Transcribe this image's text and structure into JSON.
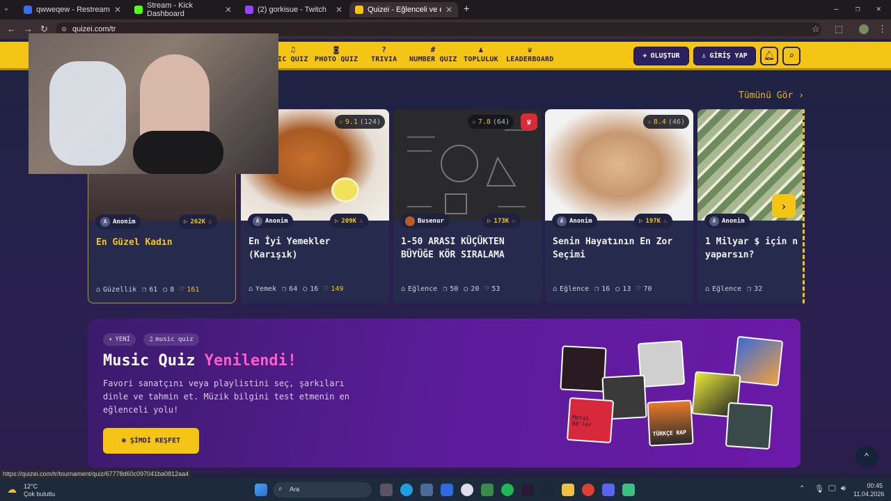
{
  "browser": {
    "tabs": [
      {
        "title": "qwweqew - Restream",
        "color": "#3d6cf2"
      },
      {
        "title": "Stream - Kick Dashboard",
        "color": "#53fc18"
      },
      {
        "title": "(2) gorkisue - Twitch",
        "color": "#9146ff"
      },
      {
        "title": "Quizei - Eğlenceli ve etkileşimli",
        "color": "#f5c515"
      }
    ],
    "url": "quizei.com/tr"
  },
  "header": {
    "nav": [
      {
        "icon": "♫",
        "label": "IC QUIZ"
      },
      {
        "icon": "◙",
        "label": "PHOTO QUIZ"
      },
      {
        "icon": "?",
        "label": "TRIVIA"
      },
      {
        "icon": "#",
        "label": "NUMBER QUIZ"
      },
      {
        "icon": "♟",
        "label": "TOPLULUK"
      },
      {
        "icon": "♛",
        "label": "LEADERBOARD"
      }
    ],
    "create_label": "OLUŞTUR",
    "login_label": "GİRİŞ YAP"
  },
  "section": {
    "see_all": "Tümünü Gör ›"
  },
  "cards": [
    {
      "rating": "",
      "rating_count": "",
      "author": "Anonim",
      "plays": "262K",
      "title": "En Güzel Kadın",
      "category": "Güzellik",
      "questions": "61",
      "comments": "8",
      "likes": "161"
    },
    {
      "rating": "9.1",
      "rating_count": "(124)",
      "author": "Anonim",
      "plays": "209K",
      "title": "En İyi Yemekler (Karışık)",
      "category": "Yemek",
      "questions": "64",
      "comments": "16",
      "likes": "149"
    },
    {
      "rating": "7.8",
      "rating_count": "(64)",
      "author": "Busenur",
      "plays": "173K",
      "title": "1-50 ARASI KÜÇÜKTEN BÜYÜĞE KÖR SIRALAMA",
      "category": "Eğlence",
      "questions": "50",
      "comments": "20",
      "likes": "53"
    },
    {
      "rating": "8.4",
      "rating_count": "(46)",
      "author": "Anonim",
      "plays": "197K",
      "title": "Senin Hayatının En Zor Seçimi",
      "category": "Eğlence",
      "questions": "16",
      "comments": "13",
      "likes": "70"
    },
    {
      "rating": "",
      "rating_count": "",
      "author": "Anonim",
      "plays": "",
      "title": "1 Milyar $ için n yaparsın?",
      "category": "Eğlence",
      "questions": "32",
      "comments": "",
      "likes": ""
    }
  ],
  "banner": {
    "tag_new": "YENİ",
    "tag_music": "music quiz",
    "title_main": "Music Quiz",
    "title_highlight": "Yenilendi!",
    "description": "Favori sanatçını veya playlistini seç, şarkıları dinle ve tahmin et. Müzik bilgini test etmenin en eğlenceli yolu!",
    "button": "ŞİMDİ KEŞFET",
    "album_text_1": "Metal",
    "album_text_2": "80'ler",
    "album_text_3": "TÜRKÇE RAP"
  },
  "status_url": "https://quizei.com/tr/tournament/quiz/67778d60c097041ba0812aa4",
  "taskbar": {
    "weather_temp": "12°C",
    "weather_desc": "Çok bulutlu",
    "search_placeholder": "Ara",
    "time": "00:45",
    "date": "11.04.2026"
  }
}
